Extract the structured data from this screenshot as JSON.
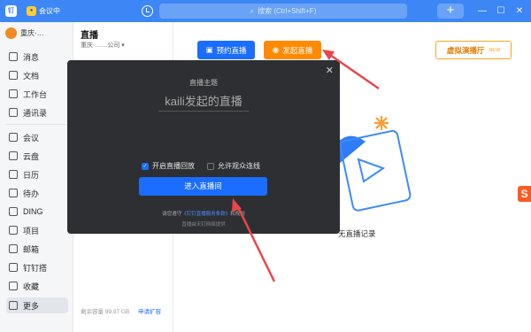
{
  "titlebar": {
    "logo": "钉",
    "meeting_label": "会议中",
    "search_placeholder": "搜索 (Ctrl+Shift+F)",
    "add_symbol": "+",
    "minimize": "—",
    "maximize": "☐",
    "close": "✕"
  },
  "sidebar": {
    "org_name": "重庆·…",
    "items": [
      {
        "label": "消息",
        "icon": "chat-icon"
      },
      {
        "label": "文档",
        "icon": "doc-icon"
      },
      {
        "label": "工作台",
        "icon": "grid-icon"
      },
      {
        "label": "通讯录",
        "icon": "contacts-icon"
      },
      {
        "label": "会议",
        "icon": "video-icon"
      },
      {
        "label": "云盘",
        "icon": "cloud-icon"
      },
      {
        "label": "日历",
        "icon": "calendar-icon"
      },
      {
        "label": "待办",
        "icon": "todo-icon"
      },
      {
        "label": "DING",
        "icon": "ding-icon"
      },
      {
        "label": "项目",
        "icon": "project-icon"
      },
      {
        "label": "邮箱",
        "icon": "mail-icon"
      },
      {
        "label": "钉钉搭",
        "icon": "builder-icon"
      },
      {
        "label": "收藏",
        "icon": "star-icon"
      },
      {
        "label": "更多",
        "icon": "more-icon"
      }
    ]
  },
  "col2": {
    "title": "直播",
    "org": "重庆·……公司 ▾",
    "storage": "剩余容量 99.97 GB",
    "expand": "申请扩容"
  },
  "main": {
    "book_live": "预约直播",
    "start_live": "发起直播",
    "ranking": "虚拟演播厅",
    "ranking_badge": "NEW",
    "empty": "无直播记录"
  },
  "modal": {
    "label": "直播主题",
    "topic": "kaili发起的直播",
    "replay": "开启直播回放",
    "allow_connect": "允许观众连线",
    "enter": "进入直播间",
    "agree_prefix": "请您遵守",
    "agree_link": "《钉钉直播服务条款》",
    "agree_suffix": "和规则",
    "provider": "直播由天钉网络提供"
  },
  "colors": {
    "primary": "#1a6dff",
    "orange": "#ff8a00",
    "titlebar": "#3d86f5",
    "arrow": "#e8464b"
  }
}
